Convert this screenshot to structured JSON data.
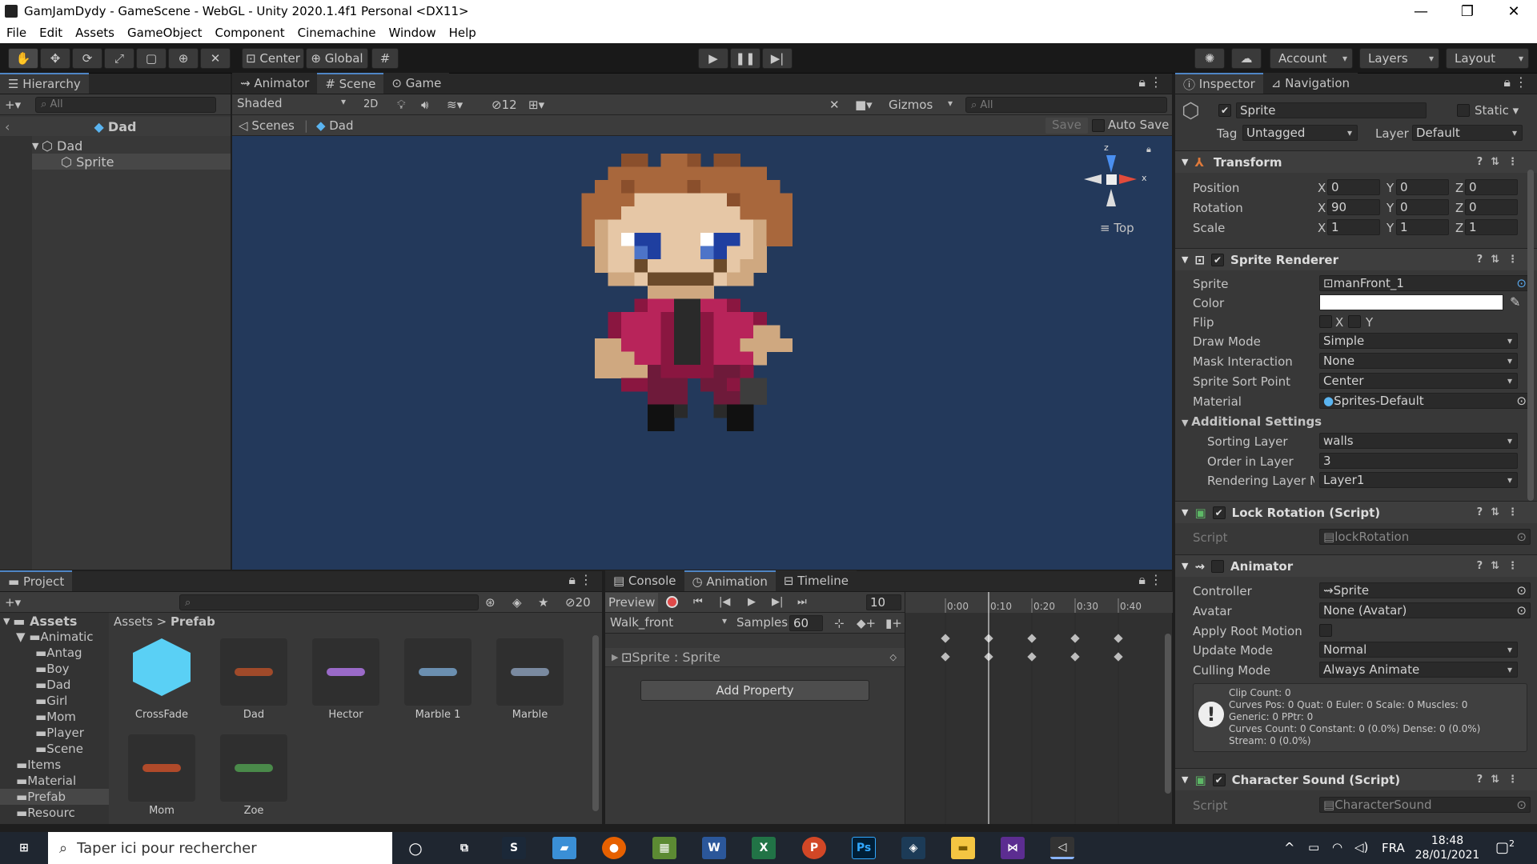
{
  "window": {
    "title": "GamJamDydy - GameScene - WebGL - Unity 2020.1.4f1 Personal <DX11>",
    "min": "—",
    "restore": "❐",
    "close": "✕"
  },
  "menu": [
    "File",
    "Edit",
    "Assets",
    "GameObject",
    "Component",
    "Cinemachine",
    "Window",
    "Help"
  ],
  "toolbar": {
    "center": "Center",
    "global": "Global",
    "account": "Account",
    "layers": "Layers",
    "layout": "Layout"
  },
  "hierarchy": {
    "tab": "Hierarchy",
    "search_placeholder": "All",
    "scene": "Dad",
    "items": [
      "Dad",
      "Sprite"
    ]
  },
  "scene_view": {
    "tabs": [
      "Animator",
      "Scene",
      "Game"
    ],
    "shading": "Shaded",
    "mode2d": "2D",
    "hidden_count": "12",
    "gizmos": "Gizmos",
    "search_placeholder": "All",
    "breadcrumb": [
      "Scenes",
      "Dad"
    ],
    "save": "Save",
    "auto_save": "Auto Save",
    "orientation": "Top",
    "axis_x": "x",
    "axis_z": "z"
  },
  "project": {
    "tab": "Project",
    "count": "20",
    "tree_root": "Assets",
    "tree": [
      {
        "label": "Animatic",
        "indent": 1
      },
      {
        "label": "Antag",
        "indent": 2
      },
      {
        "label": "Boy",
        "indent": 2
      },
      {
        "label": "Dad",
        "indent": 2
      },
      {
        "label": "Girl",
        "indent": 2
      },
      {
        "label": "Mom",
        "indent": 2
      },
      {
        "label": "Player",
        "indent": 2
      },
      {
        "label": "Scene",
        "indent": 2
      },
      {
        "label": "Items",
        "indent": 1
      },
      {
        "label": "Material",
        "indent": 1
      },
      {
        "label": "Prefab",
        "indent": 1
      },
      {
        "label": "Resourc",
        "indent": 1
      }
    ],
    "breadcrumb": [
      "Assets",
      "Prefab"
    ],
    "assets": [
      "CrossFade",
      "Dad",
      "Hector",
      "Marble 1",
      "Marble",
      "Mom",
      "Zoe"
    ]
  },
  "animation": {
    "tabs": [
      "Console",
      "Animation",
      "Timeline"
    ],
    "preview": "Preview",
    "frame": "10",
    "clip": "Walk_front",
    "samples_label": "Samples",
    "samples": "60",
    "property": "Sprite : Sprite",
    "add_property": "Add Property",
    "times": [
      "0:00",
      "0:10",
      "0:20",
      "0:30",
      "0:40"
    ]
  },
  "inspector": {
    "tabs": [
      "Inspector",
      "Navigation"
    ],
    "object_name": "Sprite",
    "static": "Static",
    "tag_label": "Tag",
    "tag": "Untagged",
    "layer_label": "Layer",
    "layer": "Default",
    "transform": {
      "title": "Transform",
      "rows": [
        {
          "label": "Position",
          "x": "0",
          "y": "0",
          "z": "0"
        },
        {
          "label": "Rotation",
          "x": "90",
          "y": "0",
          "z": "0"
        },
        {
          "label": "Scale",
          "x": "1",
          "y": "1",
          "z": "1"
        }
      ]
    },
    "sprite_renderer": {
      "title": "Sprite Renderer",
      "sprite_label": "Sprite",
      "sprite": "manFront_1",
      "color_label": "Color",
      "flip_label": "Flip",
      "flip_x": "X",
      "flip_y": "Y",
      "draw_mode_label": "Draw Mode",
      "draw_mode": "Simple",
      "mask_label": "Mask Interaction",
      "mask": "None",
      "sort_point_label": "Sprite Sort Point",
      "sort_point": "Center",
      "material_label": "Material",
      "material": "Sprites-Default",
      "additional": "Additional Settings",
      "sorting_layer_label": "Sorting Layer",
      "sorting_layer": "walls",
      "order_label": "Order in Layer",
      "order": "3",
      "rendering_layer_label": "Rendering Layer M",
      "rendering_layer": "Layer1"
    },
    "lock_rotation": {
      "title": "Lock Rotation (Script)",
      "script_label": "Script",
      "script": "lockRotation"
    },
    "animator": {
      "title": "Animator",
      "controller_label": "Controller",
      "controller": "Sprite",
      "avatar_label": "Avatar",
      "avatar": "None (Avatar)",
      "root_motion_label": "Apply Root Motion",
      "update_label": "Update Mode",
      "update": "Normal",
      "culling_label": "Culling Mode",
      "culling": "Always Animate",
      "info": [
        "Clip Count: 0",
        "Curves Pos: 0 Quat: 0 Euler: 0 Scale: 0 Muscles: 0",
        "Generic: 0 PPtr: 0",
        "Curves Count: 0 Constant: 0 (0.0%) Dense: 0 (0.0%)",
        "Stream: 0 (0.0%)"
      ]
    },
    "character_sound": {
      "title": "Character Sound (Script)",
      "script_label": "Script",
      "script": "CharacterSound"
    }
  },
  "taskbar": {
    "search_placeholder": "Taper ici pour rechercher",
    "lang": "FRA",
    "time": "18:48",
    "date": "28/01/2021",
    "notif": "2"
  },
  "colors": {
    "accent": "#4f86c6",
    "scene_bg": "#23395b",
    "record": "#e04a4a"
  }
}
